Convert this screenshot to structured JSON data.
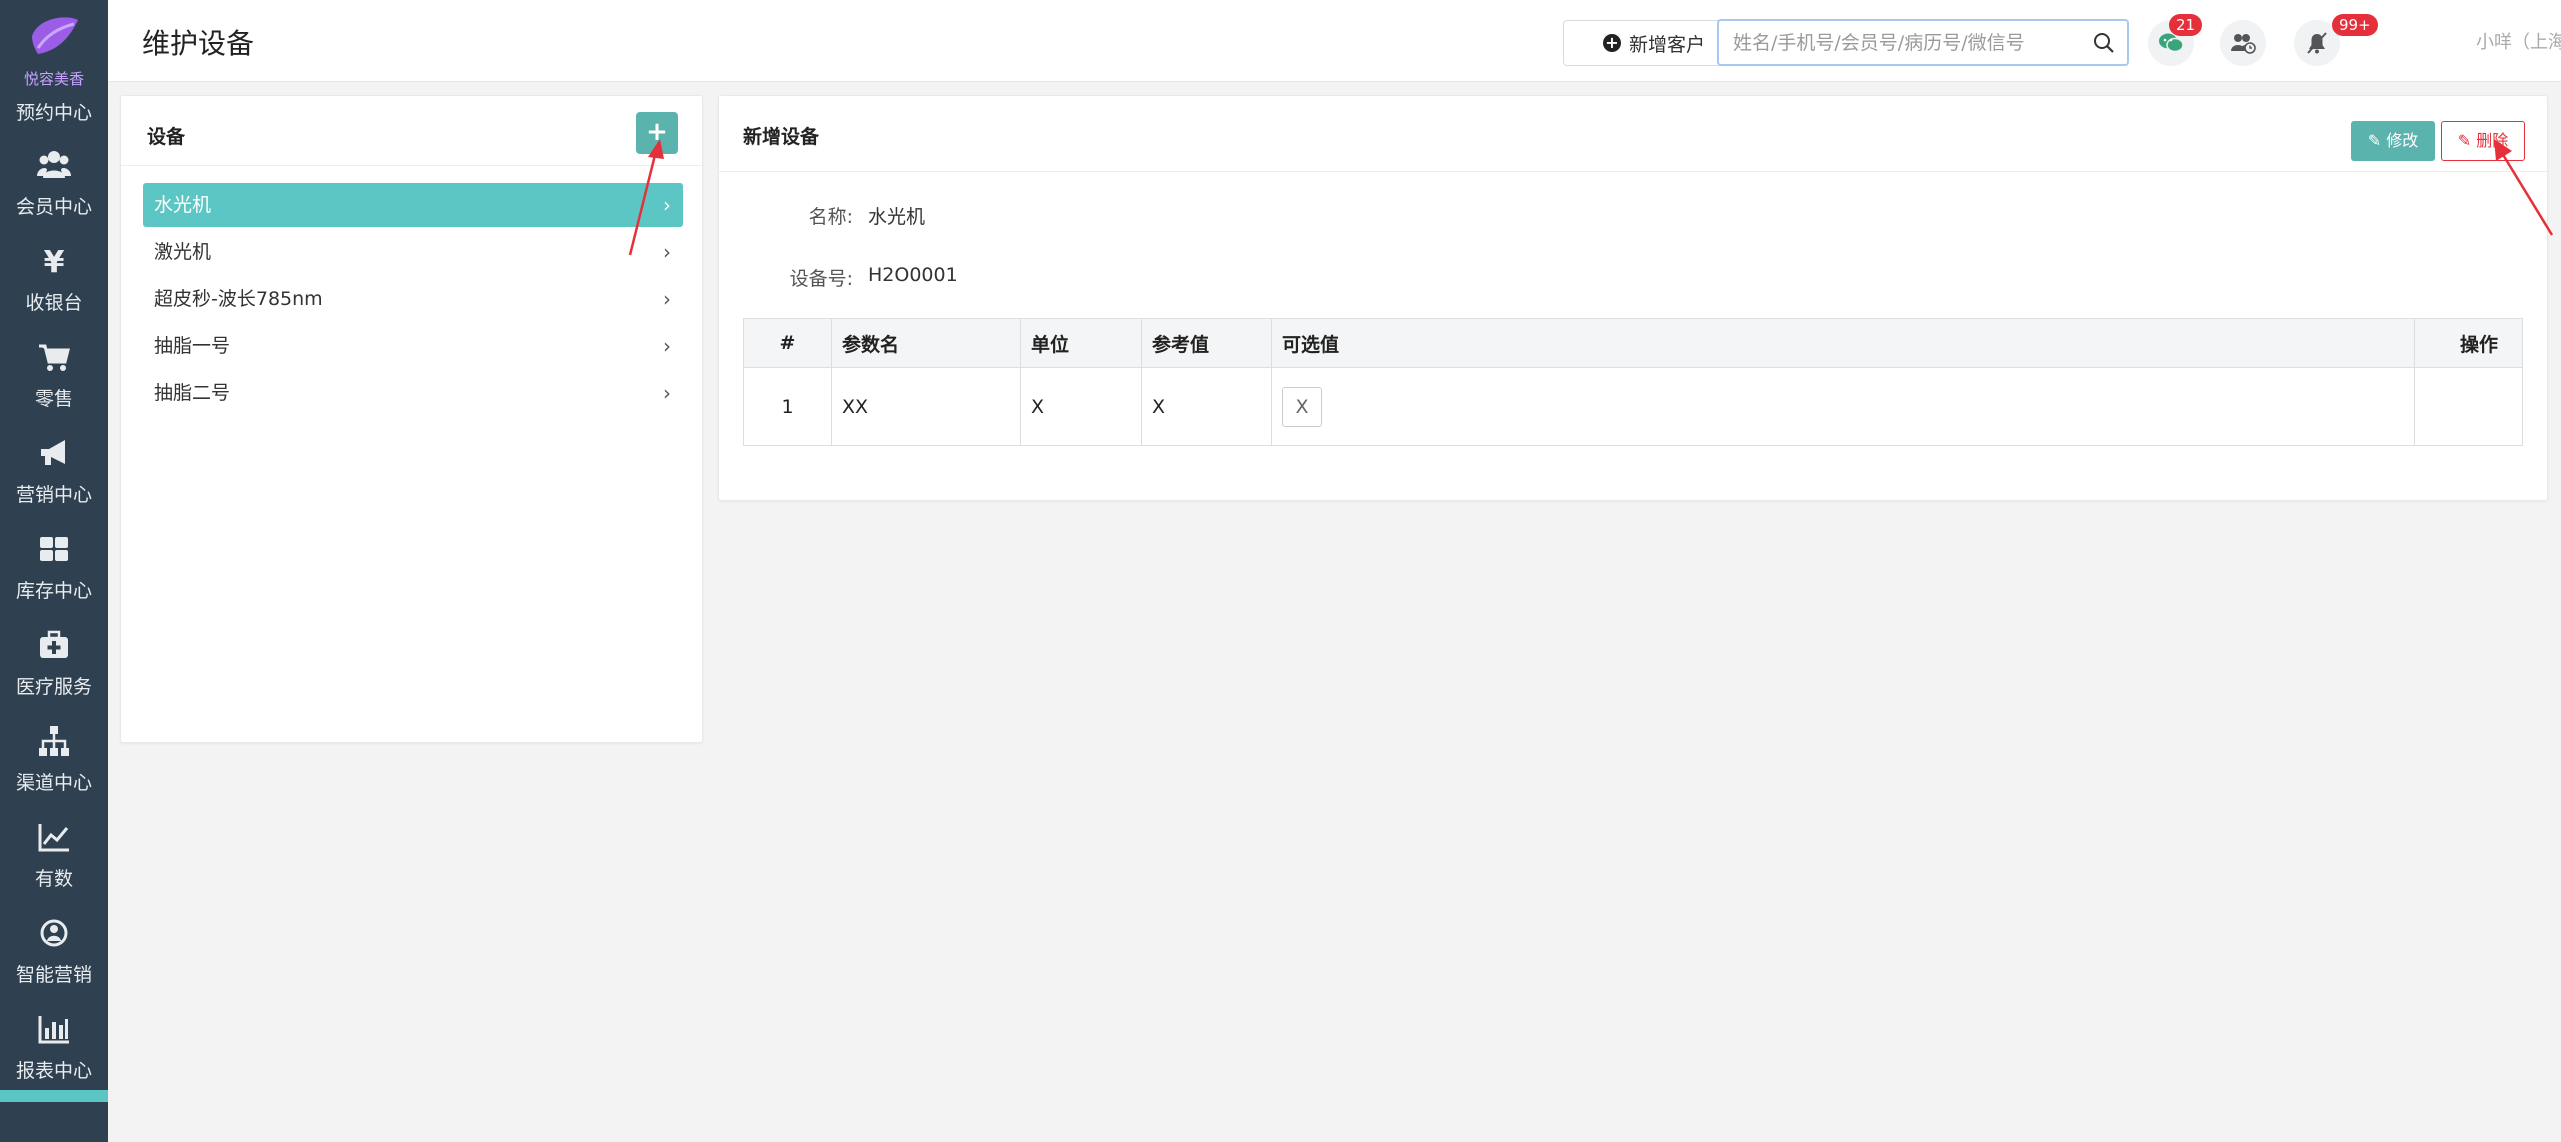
{
  "sidebar": {
    "brand": "悦容美香",
    "partial_item": "预约中心",
    "items": [
      {
        "label": "会员中心",
        "icon": "users-icon"
      },
      {
        "label": "收银台",
        "icon": "yen-icon"
      },
      {
        "label": "零售",
        "icon": "cart-icon"
      },
      {
        "label": "营销中心",
        "icon": "megaphone-icon"
      },
      {
        "label": "库存中心",
        "icon": "grid-icon"
      },
      {
        "label": "医疗服务",
        "icon": "medkit-icon"
      },
      {
        "label": "渠道中心",
        "icon": "sitemap-icon"
      },
      {
        "label": "有数",
        "icon": "line-chart-icon"
      },
      {
        "label": "智能营销",
        "icon": "brain-icon"
      },
      {
        "label": "报表中心",
        "icon": "bar-chart-icon"
      }
    ]
  },
  "header": {
    "title": "维护设备",
    "add_customer_label": "新增客户",
    "search_placeholder": "姓名/手机号/会员号/病历号/微信号",
    "wechat_badge": "21",
    "notify_badge": "99+",
    "user": "小咩（上海闵江门诊）"
  },
  "left_panel": {
    "title": "设备",
    "devices": [
      "水光机",
      "激光机",
      "超皮秒-波长785nm",
      "抽脂一号",
      "抽脂二号"
    ],
    "active_index": 0
  },
  "right_panel": {
    "title": "新增设备",
    "edit_label": "修改",
    "delete_label": "删除",
    "name_label": "名称:",
    "name_value": "水光机",
    "code_label": "设备号:",
    "code_value": "H2O0001",
    "table": {
      "headers": [
        "#",
        "参数名",
        "单位",
        "参考值",
        "可选值",
        "操作"
      ],
      "rows": [
        {
          "index": "1",
          "name": "XX",
          "unit": "X",
          "ref": "X",
          "option": "X"
        }
      ]
    }
  },
  "colors": {
    "sidebar_bg": "#2f4050",
    "accent": "#5bc6c3",
    "button_teal": "#5ab3ad",
    "danger": "#e5303b"
  }
}
